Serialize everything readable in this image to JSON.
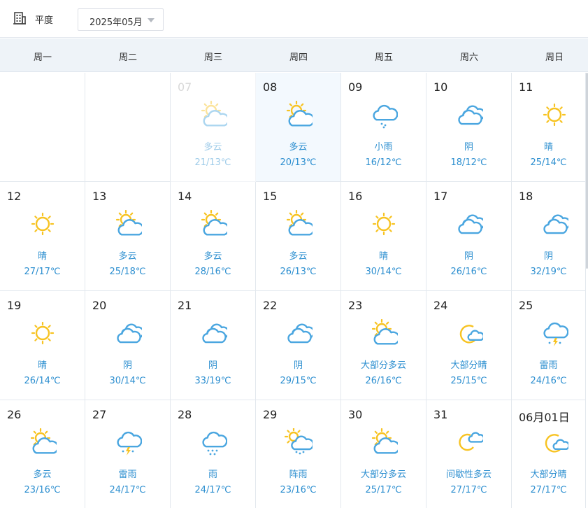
{
  "header": {
    "city_icon": "building-icon",
    "city": "平度",
    "month": "2025年05月",
    "dropdown_icon": "caret-down-icon"
  },
  "weekdays": [
    "周一",
    "周二",
    "周三",
    "周四",
    "周五",
    "周六",
    "周日"
  ],
  "days": [
    {
      "day": "",
      "desc": "",
      "temp": "",
      "icon": "none"
    },
    {
      "day": "",
      "desc": "",
      "temp": "",
      "icon": "none"
    },
    {
      "day": "07",
      "desc": "多云",
      "temp": "21/13℃",
      "icon": "partly-cloudy",
      "state": "past"
    },
    {
      "day": "08",
      "desc": "多云",
      "temp": "20/13℃",
      "icon": "partly-cloudy",
      "state": "today"
    },
    {
      "day": "09",
      "desc": "小雨",
      "temp": "16/12℃",
      "icon": "light-rain"
    },
    {
      "day": "10",
      "desc": "阴",
      "temp": "18/12℃",
      "icon": "overcast"
    },
    {
      "day": "11",
      "desc": "晴",
      "temp": "25/14℃",
      "icon": "sunny"
    },
    {
      "day": "12",
      "desc": "晴",
      "temp": "27/17℃",
      "icon": "sunny"
    },
    {
      "day": "13",
      "desc": "多云",
      "temp": "25/18℃",
      "icon": "partly-cloudy"
    },
    {
      "day": "14",
      "desc": "多云",
      "temp": "28/16℃",
      "icon": "partly-cloudy"
    },
    {
      "day": "15",
      "desc": "多云",
      "temp": "26/13℃",
      "icon": "partly-cloudy"
    },
    {
      "day": "16",
      "desc": "晴",
      "temp": "30/14℃",
      "icon": "sunny"
    },
    {
      "day": "17",
      "desc": "阴",
      "temp": "26/16℃",
      "icon": "overcast"
    },
    {
      "day": "18",
      "desc": "阴",
      "temp": "32/19℃",
      "icon": "overcast"
    },
    {
      "day": "19",
      "desc": "晴",
      "temp": "26/14℃",
      "icon": "sunny"
    },
    {
      "day": "20",
      "desc": "阴",
      "temp": "30/14℃",
      "icon": "overcast"
    },
    {
      "day": "21",
      "desc": "阴",
      "temp": "33/19℃",
      "icon": "overcast"
    },
    {
      "day": "22",
      "desc": "阴",
      "temp": "29/15℃",
      "icon": "overcast"
    },
    {
      "day": "23",
      "desc": "大部分多云",
      "temp": "26/16℃",
      "icon": "partly-cloudy"
    },
    {
      "day": "24",
      "desc": "大部分晴",
      "temp": "25/15℃",
      "icon": "mostly-sunny"
    },
    {
      "day": "25",
      "desc": "雷雨",
      "temp": "24/16℃",
      "icon": "thunderstorm"
    },
    {
      "day": "26",
      "desc": "多云",
      "temp": "23/16℃",
      "icon": "partly-cloudy"
    },
    {
      "day": "27",
      "desc": "雷雨",
      "temp": "24/17℃",
      "icon": "thunder-shower"
    },
    {
      "day": "28",
      "desc": "雨",
      "temp": "24/17℃",
      "icon": "rain"
    },
    {
      "day": "29",
      "desc": "阵雨",
      "temp": "23/16℃",
      "icon": "shower"
    },
    {
      "day": "30",
      "desc": "大部分多云",
      "temp": "25/17℃",
      "icon": "partly-cloudy"
    },
    {
      "day": "31",
      "desc": "间歇性多云",
      "temp": "27/17℃",
      "icon": "intermittent-cloudy"
    },
    {
      "day": "06月01日",
      "desc": "大部分晴",
      "temp": "27/17℃",
      "icon": "mostly-sunny"
    }
  ],
  "colors": {
    "sun": "#f7c322",
    "cloud": "#4aa6e0",
    "text_accent": "#2d8fd0",
    "today_bg": "#f3f9fe"
  }
}
